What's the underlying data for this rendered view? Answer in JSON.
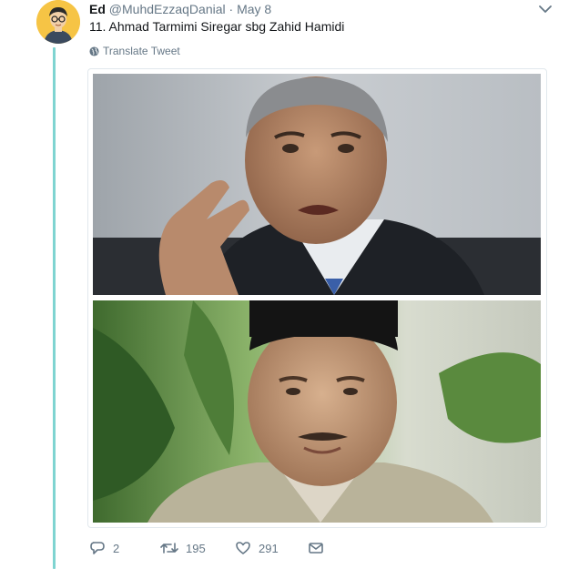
{
  "tweet": {
    "display_name": "Ed",
    "handle": "@MuhdEzzaqDanial",
    "separator": "·",
    "date": "May 8",
    "text": "11. Ahmad Tarmimi Siregar sbg Zahid Hamidi",
    "translate_label": "Translate Tweet"
  },
  "icons": {
    "caret": "chevron-down-icon",
    "translate": "globe-icon",
    "reply": "reply-icon",
    "retweet": "retweet-icon",
    "like": "heart-icon",
    "dm": "envelope-icon"
  },
  "actions": {
    "reply_count": "2",
    "retweet_count": "195",
    "like_count": "291"
  },
  "colors": {
    "thread_line": "#7fd4d1",
    "secondary_text": "#657786",
    "avatar_bg": "#f6c445"
  }
}
